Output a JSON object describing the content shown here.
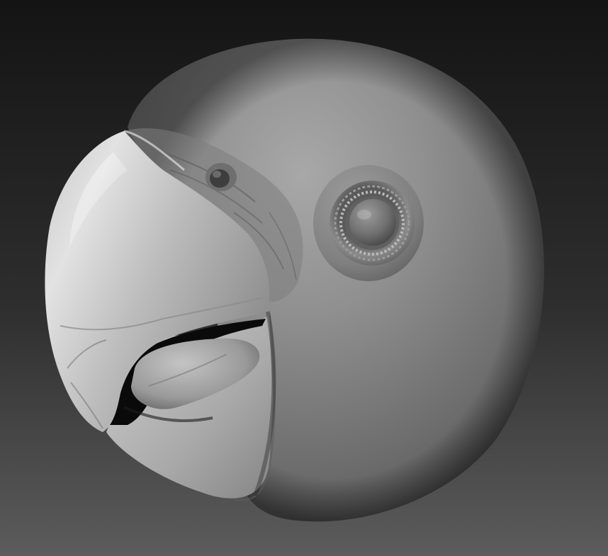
{
  "scene": {
    "subject": "parrot-head-sculpt",
    "material": "matcap-gray",
    "colors": {
      "background_top": "#141414",
      "background_bottom": "#5a5a5a",
      "clay_highlight": "#bdbdbd",
      "clay_mid": "#8c8c8c",
      "clay_shadow": "#3d3d3d",
      "beak_highlight": "#e6e6e6",
      "mouth_shadow": "#0a0a0a"
    }
  }
}
